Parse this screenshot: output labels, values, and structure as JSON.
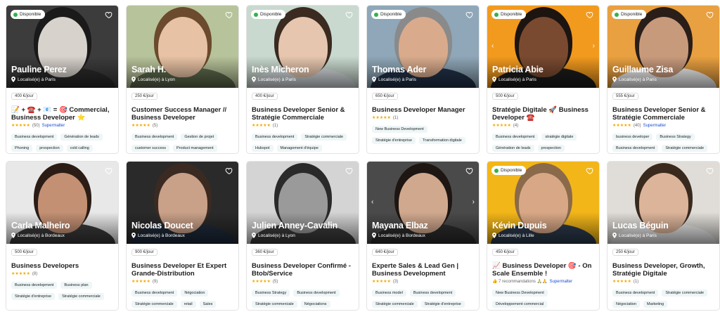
{
  "available_label": "Disponible",
  "supermalter_label": "Supermalter",
  "freelancers": [
    {
      "name": "Pauline Perez",
      "location": "Localisé(e) à Paris",
      "rate": "400 €/jour",
      "available": true,
      "title": "📝 + ☎️ + 📧 = 🎯 Commercial, Business Developer ⭐",
      "stars": "★★★★★",
      "reviews": "(50)",
      "supermalter": true,
      "tags": [
        "Business development",
        "Génération de leads",
        "Phoning",
        "prospection",
        "cold calling"
      ],
      "photo_bg": "#3c3c3c",
      "skin": "#d8d2cc",
      "hair": "#1a1a1a",
      "shirt": "#2a2a2a"
    },
    {
      "name": "Sarah H.",
      "location": "Localisé(e) à Lyon",
      "rate": "250 €/jour",
      "available": false,
      "title": "Customer Success Manager // Business Developer",
      "stars": "★★★★★",
      "reviews": "(5)",
      "supermalter": false,
      "tags": [
        "Business development",
        "Gestion de projet",
        "customer success",
        "Product management"
      ],
      "photo_bg": "#b7c39a",
      "skin": "#e8c2a4",
      "hair": "#6b4a2e",
      "shirt": "#5e6a4c"
    },
    {
      "name": "Inès Micheron",
      "location": "Localisé(e) à Paris",
      "rate": "400 €/jour",
      "available": true,
      "title": "Business Developer Senior & Stratégie Commerciale",
      "stars": "★★★★★",
      "reviews": "(1)",
      "supermalter": false,
      "tags": [
        "Business development",
        "Stratégie commerciale",
        "Hubspot",
        "Management d'équipe"
      ],
      "photo_bg": "#c9d9cf",
      "skin": "#e6c6ae",
      "hair": "#3a2a20",
      "shirt": "#d7dde0"
    },
    {
      "name": "Thomas Ader",
      "location": "Localisé(e) à Paris",
      "rate": "650 €/jour",
      "available": true,
      "title": "Business Developer Manager",
      "stars": "★★★★★",
      "reviews": "(1)",
      "supermalter": false,
      "tags": [
        "New Business Development",
        "Stratégie d'entreprise",
        "Transformation digitale"
      ],
      "photo_bg": "#8fa7b8",
      "skin": "#d9ab8c",
      "hair": "#8a8a8a",
      "shirt": "#22324a"
    },
    {
      "name": "Patricia Abie",
      "location": "Localisé(e) à Paris",
      "rate": "500 €/jour",
      "available": true,
      "title": "Stratégie Digitale 🚀 Business Developer ☎️",
      "stars": "★★★★★",
      "reviews": "(4)",
      "supermalter": false,
      "tags": [
        "Business development",
        "stratégie digitale",
        "Génération de leads",
        "prospection"
      ],
      "photo_bg": "#f29a1e",
      "skin": "#7a4a30",
      "hair": "#1c1410",
      "shirt": "#1c1c1c"
    },
    {
      "name": "Guillaume Zisa",
      "location": "Localisé(e) à Paris",
      "rate": "555 €/jour",
      "available": true,
      "title": "Business Developer Senior & Stratégie Commerciale",
      "stars": "★★★★★",
      "reviews": "(40)",
      "supermalter": true,
      "tags": [
        "business developer",
        "Business Strategy",
        "Business development",
        "Stratégie commerciale"
      ],
      "photo_bg": "#e9a040",
      "skin": "#c89a7c",
      "hair": "#2a1e18",
      "shirt": "#f4f4f4"
    },
    {
      "name": "Carla Malheiro",
      "location": "Localisé(e) à Bordeaux",
      "rate": "500 €/jour",
      "available": false,
      "title": "Business Developers",
      "stars": "★★★★★",
      "reviews": "(8)",
      "supermalter": false,
      "tags": [
        "Business development",
        "Business plan",
        "Stratégie d'entreprise",
        "Stratégie commerciale"
      ],
      "photo_bg": "#e8e8e8",
      "skin": "#c39074",
      "hair": "#2b1d16",
      "shirt": "#3a3a3a"
    },
    {
      "name": "Nicolas Doucet",
      "location": "Localisé(e) à Bordeaux",
      "rate": "900 €/jour",
      "available": false,
      "title": "Business Developer Et Expert Grande-Distribution",
      "stars": "★★★★★",
      "reviews": "(9)",
      "supermalter": false,
      "tags": [
        "Business development",
        "Négociation",
        "Stratégie commerciale",
        "retail",
        "Sales"
      ],
      "photo_bg": "#2a2a2a",
      "skin": "#c9a088",
      "hair": "#3a2a22",
      "shirt": "#1e2a3a"
    },
    {
      "name": "Julien Anney-Cavalin",
      "location": "Localisé(e) à Lyon",
      "rate": "360 €/jour",
      "available": false,
      "title": "Business Developer Confirmé - Btob/Service",
      "stars": "★★★★★",
      "reviews": "(5)",
      "supermalter": false,
      "tags": [
        "Business Strategy",
        "Business development",
        "Stratégie commerciale",
        "Négociations"
      ],
      "photo_bg": "#d4d4d4",
      "skin": "#9a9a9a",
      "hair": "#2a2a2a",
      "shirt": "#3c3c3c"
    },
    {
      "name": "Mayana Elbaz",
      "location": "Localisé(e) à Bordeaux",
      "rate": "640 €/jour",
      "available": false,
      "title": "Experte Sales & Lead Gen | Business Development",
      "stars": "★★★★★",
      "reviews": "(3)",
      "supermalter": false,
      "tags": [
        "Business model",
        "Business development",
        "Stratégie commerciale",
        "Stratégie d'entreprise"
      ],
      "photo_bg": "#4a4a4a",
      "skin": "#d0a88e",
      "hair": "#1e1612",
      "shirt": "#2c2c2c"
    },
    {
      "name": "Kévin Dupuis",
      "location": "Localisé(e) à Lille",
      "rate": "450 €/jour",
      "available": true,
      "title": "📈 Business Developer 🎯 - On Scale Ensemble !",
      "stars": "",
      "reviews": "👍 7 recommandations 🙏🙏",
      "supermalter": true,
      "tags": [
        "New Business Development",
        "Développement commercial"
      ],
      "photo_bg": "#f3b619",
      "skin": "#d8a886",
      "hair": "#8a6a4a",
      "shirt": "#2c3a4c"
    },
    {
      "name": "Lucas Béguin",
      "location": "Localisé(e) à Paris",
      "rate": "250 €/jour",
      "available": false,
      "title": "Business Developer, Growth, Stratégie Digitale",
      "stars": "★★★★★",
      "reviews": "(1)",
      "supermalter": false,
      "tags": [
        "Business development",
        "Stratégie commerciale",
        "Négociation",
        "Marketing"
      ],
      "photo_bg": "#e0ddd8",
      "skin": "#dcb49a",
      "hair": "#3a2a1e",
      "shirt": "#eaeaea"
    }
  ]
}
